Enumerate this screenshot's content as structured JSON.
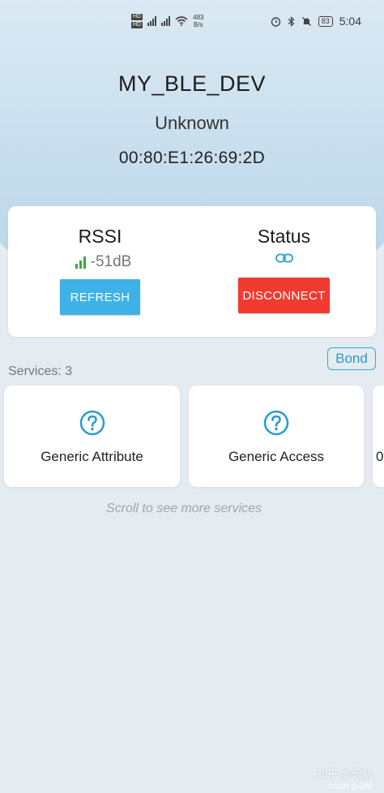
{
  "status_bar": {
    "sim_labels": [
      "HD",
      "HD"
    ],
    "speed": [
      "483",
      "B/s"
    ],
    "battery": "83",
    "time": "5:04",
    "icons": [
      "alarm-icon",
      "bluetooth-icon",
      "mute-icon",
      "battery-icon",
      "signal-icon",
      "wifi-icon"
    ]
  },
  "device": {
    "name": "MY_BLE_DEV",
    "type": "Unknown",
    "mac": "00:80:E1:26:69:2D"
  },
  "info_card": {
    "rssi_title": "RSSI",
    "rssi_value": "-51dB",
    "status_title": "Status",
    "refresh_label": "REFRESH",
    "disconnect_label": "DISCONNECT",
    "status_icon": "link-icon"
  },
  "bond_label": "Bond",
  "services": {
    "label": "Services: 3",
    "items": [
      {
        "name": "Generic Attribute",
        "icon": "question-icon"
      },
      {
        "name": "Generic Access",
        "icon": "question-icon"
      },
      {
        "name": "0",
        "icon": "question-icon"
      }
    ],
    "scroll_hint": "Scroll to see more services"
  },
  "watermark": {
    "line1": "知乎 @记航",
    "line2": "CSDN @记航"
  },
  "colors": {
    "accent": "#3eb2e6",
    "danger": "#f13a30",
    "signal": "#3aa845",
    "link": "#3aa8d4"
  }
}
